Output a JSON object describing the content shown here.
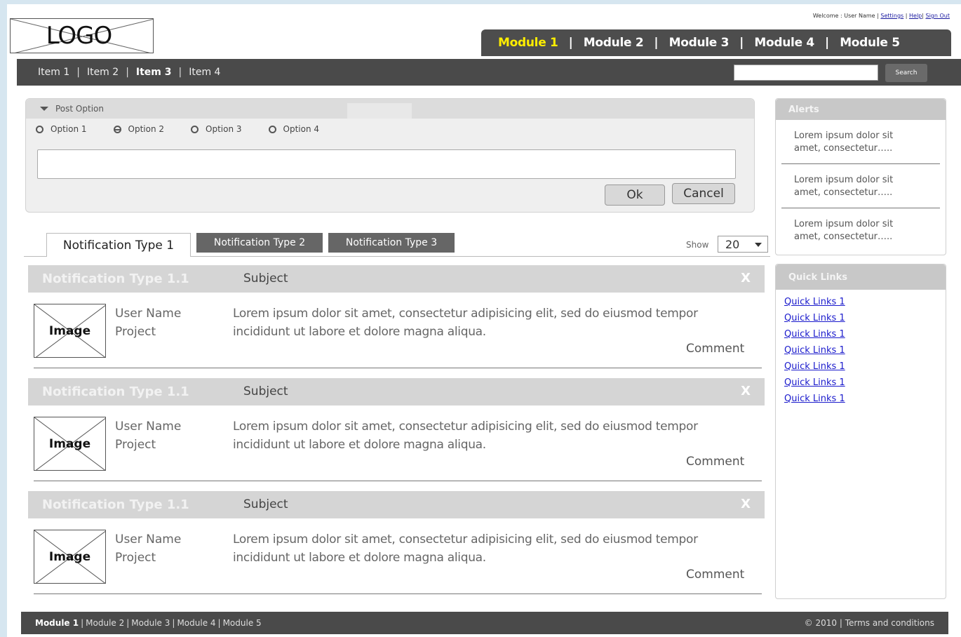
{
  "header": {
    "logo_text": "LOGO",
    "welcome_text": "Welcome : User  Name  |",
    "settings_link": "Settings",
    "help_link": "Help",
    "signout_link": "Sign Out"
  },
  "modules": [
    {
      "label": "Module 1",
      "active": true
    },
    {
      "label": "Module 2",
      "active": false
    },
    {
      "label": "Module 3",
      "active": false
    },
    {
      "label": "Module 4",
      "active": false
    },
    {
      "label": "Module 5",
      "active": false
    }
  ],
  "subnav": {
    "items": [
      {
        "label": "Item 1",
        "active": false
      },
      {
        "label": "Item 2",
        "active": false
      },
      {
        "label": "Item 3",
        "active": true
      },
      {
        "label": "Item 4",
        "active": false
      }
    ],
    "search_value": "",
    "search_button": "Search"
  },
  "post": {
    "title": "Post Option",
    "options": [
      {
        "label": "Option 1",
        "checked": false
      },
      {
        "label": "Option 2",
        "checked": true
      },
      {
        "label": "Option 3",
        "checked": false
      },
      {
        "label": "Option 4",
        "checked": false
      }
    ],
    "text_value": "",
    "ok_label": "Ok",
    "cancel_label": "Cancel"
  },
  "tabs": {
    "tab1": "Notification Type 1",
    "tab2": "Notification Type 2",
    "tab3": "Notification Type 3",
    "show_label": "Show",
    "show_value": "20"
  },
  "notifications": [
    {
      "type": "Notification Type 1.1",
      "subject": "Subject",
      "close": "X",
      "image": "Image",
      "user": "User Name",
      "project": "Project",
      "body_line1": "Lorem ipsum dolor sit amet, consectetur adipisicing elit, sed do eiusmod tempor",
      "body_line2": "incididunt ut labore et dolore magna aliqua.",
      "comment": "Comment"
    },
    {
      "type": "Notification Type 1.1",
      "subject": "Subject",
      "close": "X",
      "image": "Image",
      "user": "User Name",
      "project": "Project",
      "body_line1": "Lorem ipsum dolor sit amet, consectetur adipisicing elit, sed do eiusmod tempor",
      "body_line2": "incididunt ut labore et dolore magna aliqua.",
      "comment": "Comment"
    },
    {
      "type": "Notification Type 1.1",
      "subject": "Subject",
      "close": "X",
      "image": "Image",
      "user": "User Name",
      "project": "Project",
      "body_line1": "Lorem ipsum dolor sit amet, consectetur adipisicing elit, sed do eiusmod tempor",
      "body_line2": "incididunt ut labore et dolore magna aliqua.",
      "comment": "Comment"
    }
  ],
  "alerts": {
    "title": "Alerts",
    "items": [
      {
        "line1": "Lorem ipsum dolor sit",
        "line2": "amet, consectetur….."
      },
      {
        "line1": "Lorem ipsum dolor sit",
        "line2": "amet, consectetur….."
      },
      {
        "line1": "Lorem ipsum dolor sit",
        "line2": "amet, consectetur….."
      }
    ]
  },
  "quick_links": {
    "title": "Quick Links",
    "items": [
      "Quick Links  1",
      "Quick Links  1",
      "Quick Links  1",
      "Quick Links  1",
      "Quick Links  1",
      "Quick Links  1",
      "Quick Links  1"
    ]
  },
  "footer": {
    "modules": [
      "Module 1",
      "Module 2",
      "Module 3",
      "Module 4",
      "Module 5"
    ],
    "copyright": "© 2010 |",
    "terms": "Terms and conditions"
  }
}
